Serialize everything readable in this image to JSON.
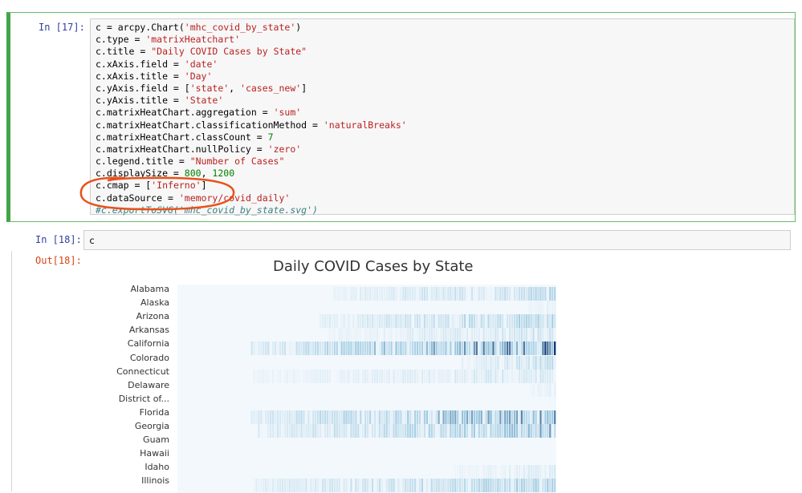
{
  "cell17": {
    "prompt": "In [17]:",
    "lines": [
      [
        {
          "t": "c = arcpy.Chart("
        },
        {
          "t": "'mhc_covid_by_state'",
          "c": "s"
        },
        {
          "t": ")"
        }
      ],
      [
        {
          "t": "c.type = "
        },
        {
          "t": "'matrixHeatchart'",
          "c": "s"
        }
      ],
      [
        {
          "t": "c.title = "
        },
        {
          "t": "\"Daily COVID Cases by State\"",
          "c": "s"
        }
      ],
      [
        {
          "t": "c.xAxis.field = "
        },
        {
          "t": "'date'",
          "c": "s"
        }
      ],
      [
        {
          "t": "c.xAxis.title = "
        },
        {
          "t": "'Day'",
          "c": "s"
        }
      ],
      [
        {
          "t": "c.yAxis.field = ["
        },
        {
          "t": "'state'",
          "c": "s"
        },
        {
          "t": ", "
        },
        {
          "t": "'cases_new'",
          "c": "s"
        },
        {
          "t": "]"
        }
      ],
      [
        {
          "t": "c.yAxis.title = "
        },
        {
          "t": "'State'",
          "c": "s"
        }
      ],
      [
        {
          "t": "c.matrixHeatChart.aggregation = "
        },
        {
          "t": "'sum'",
          "c": "s"
        }
      ],
      [
        {
          "t": "c.matrixHeatChart.classificationMethod = "
        },
        {
          "t": "'naturalBreaks'",
          "c": "s"
        }
      ],
      [
        {
          "t": "c.matrixHeatChart.classCount = "
        },
        {
          "t": "7",
          "c": "n"
        }
      ],
      [
        {
          "t": "c.matrixHeatChart.nullPolicy = "
        },
        {
          "t": "'zero'",
          "c": "s"
        }
      ],
      [
        {
          "t": "c.legend.title = "
        },
        {
          "t": "\"Number of Cases\"",
          "c": "s"
        }
      ],
      [
        {
          "t": "c.displaySize = "
        },
        {
          "t": "800",
          "c": "n"
        },
        {
          "t": ", "
        },
        {
          "t": "1200",
          "c": "n"
        }
      ],
      [
        {
          "t": "c.cmap = ["
        },
        {
          "t": "'Inferno'",
          "c": "s"
        },
        {
          "t": "]"
        }
      ],
      [
        {
          "t": "c.dataSource = "
        },
        {
          "t": "'memory/covid_daily'",
          "c": "s"
        }
      ],
      [
        {
          "t": "#c.exportToSVG('mhc_covid_by_state.svg')",
          "c": "c"
        }
      ]
    ]
  },
  "cell18": {
    "prompt_in": "In [18]:",
    "code": "c",
    "prompt_out": "Out[18]:"
  },
  "chart_data": {
    "type": "heatmap",
    "title": "Daily COVID Cases by State",
    "categories": [
      "Alabama",
      "Alaska",
      "Arizona",
      "Arkansas",
      "California",
      "Colorado",
      "Connecticut",
      "Delaware",
      "District of...",
      "Florida",
      "Georgia",
      "Guam",
      "Hawaii",
      "Idaho",
      "Illinois"
    ],
    "series": [
      {
        "start": 0.41,
        "intensity": 0.45
      },
      {
        "start": 0.92,
        "intensity": 0.15
      },
      {
        "start": 0.37,
        "intensity": 0.55
      },
      {
        "start": 0.4,
        "intensity": 0.3
      },
      {
        "start": 0.19,
        "intensity": 1.0
      },
      {
        "start": 0.75,
        "intensity": 0.4
      },
      {
        "start": 0.2,
        "intensity": 0.25
      },
      {
        "start": 0.93,
        "intensity": 0.15
      },
      {
        "start": 0.98,
        "intensity": 0.05
      },
      {
        "start": 0.19,
        "intensity": 0.85
      },
      {
        "start": 0.21,
        "intensity": 0.7
      },
      {
        "start": 1.0,
        "intensity": 0.0
      },
      {
        "start": 1.0,
        "intensity": 0.0
      },
      {
        "start": 0.72,
        "intensity": 0.2
      },
      {
        "start": 0.2,
        "intensity": 0.55
      }
    ]
  },
  "colors": {
    "heat_low": "#f3f8fc",
    "heat_high": "#08306b",
    "accent": "#42a548"
  }
}
